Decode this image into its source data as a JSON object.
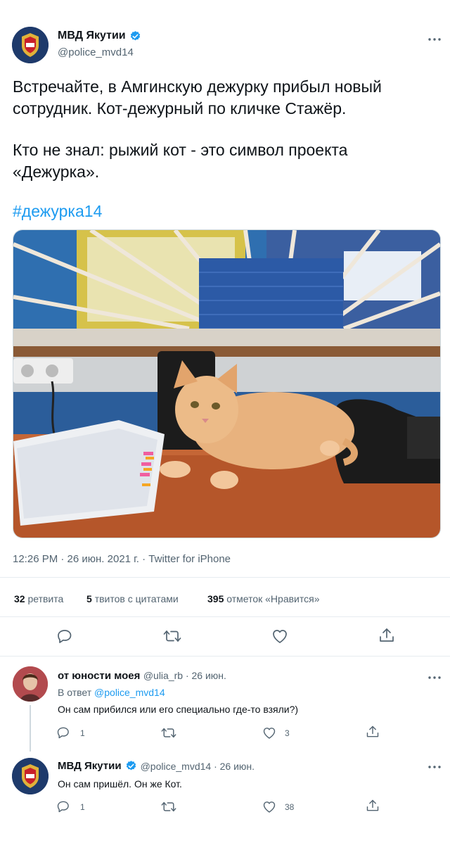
{
  "tweet": {
    "author_name": "МВД Якутии",
    "author_handle": "@police_mvd14",
    "paragraph1": "Встречайте, в Амгинскую дежурку прибыл новый сотрудник. Кот-дежурный по кличке Стажёр.",
    "paragraph2": "Кто не знал: рыжий кот - это символ проекта «Дежурка».",
    "hashtag": "#дежурка14",
    "meta": "12:26 PM · 26 июн. 2021 г. · Twitter for iPhone",
    "stats": {
      "retweets_count": "32",
      "retweets_label": "ретвита",
      "quotes_count": "5",
      "quotes_label": "твитов с цитатами",
      "likes_count": "395",
      "likes_label": "отметок «Нравится»"
    }
  },
  "reply1": {
    "author_name": "от юности моея",
    "meta": "@ulia_rb · 26 июн.",
    "reply_to_prefix": "В ответ",
    "reply_to_handle": "@police_mvd14",
    "text": "Он сам прибился или его специально где-то взяли?)",
    "reply_count": "1",
    "like_count": "3"
  },
  "reply2": {
    "author_name": "МВД Якутии",
    "meta": "@police_mvd14 · 26 июн.",
    "text": "Он сам пришёл. Он же Кот.",
    "reply_count": "1",
    "like_count": "38"
  },
  "icons": {
    "more": "more-icon",
    "reply": "reply-icon",
    "retweet": "retweet-icon",
    "like": "heart-icon",
    "share": "share-icon",
    "verified": "verified-badge-icon"
  },
  "colors": {
    "accent": "#1d9bf0",
    "text": "#0f1419",
    "secondary": "#536471",
    "divider": "#e6ecf0"
  }
}
